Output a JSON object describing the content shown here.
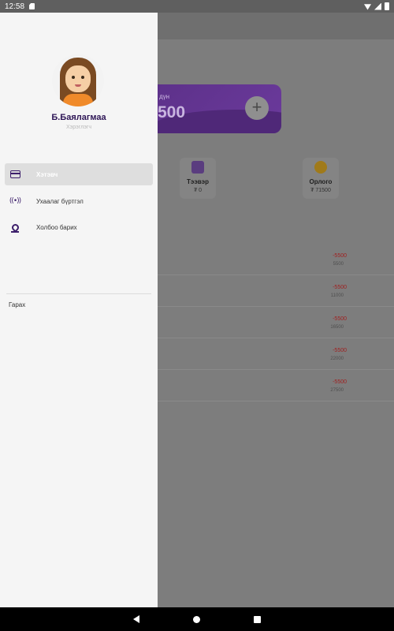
{
  "status_bar": {
    "time": "12:58"
  },
  "app": {
    "balance_label": "дүн",
    "balance_value": "500",
    "add_symbol": "+",
    "tiles": [
      {
        "label": "Тээвэр",
        "value": "₮ 0",
        "icon": "receipt-icon"
      },
      {
        "label": "Орлого",
        "value": "₮ 71500",
        "icon": "coin-icon"
      }
    ],
    "transactions": [
      {
        "amount": "-5500",
        "total": "5500"
      },
      {
        "amount": "-5500",
        "total": "11000"
      },
      {
        "amount": "-5500",
        "total": "16500"
      },
      {
        "amount": "-5500",
        "total": "22000"
      },
      {
        "amount": "-5500",
        "total": "27500"
      }
    ]
  },
  "drawer": {
    "user_name": "Б.Баялагмаа",
    "user_role": "Хэрэглэгч",
    "menu": [
      {
        "label": "Хэтэвч",
        "icon": "wallet-icon",
        "active": true
      },
      {
        "label": "Ухаалаг бүртгэл",
        "icon": "nfc-icon",
        "active": false
      },
      {
        "label": "Холбоо барих",
        "icon": "location-pin-icon",
        "active": false
      }
    ],
    "logout_label": "Гарах"
  },
  "colors": {
    "brand_purple": "#3d1f6b",
    "negative_red": "#a02020"
  }
}
